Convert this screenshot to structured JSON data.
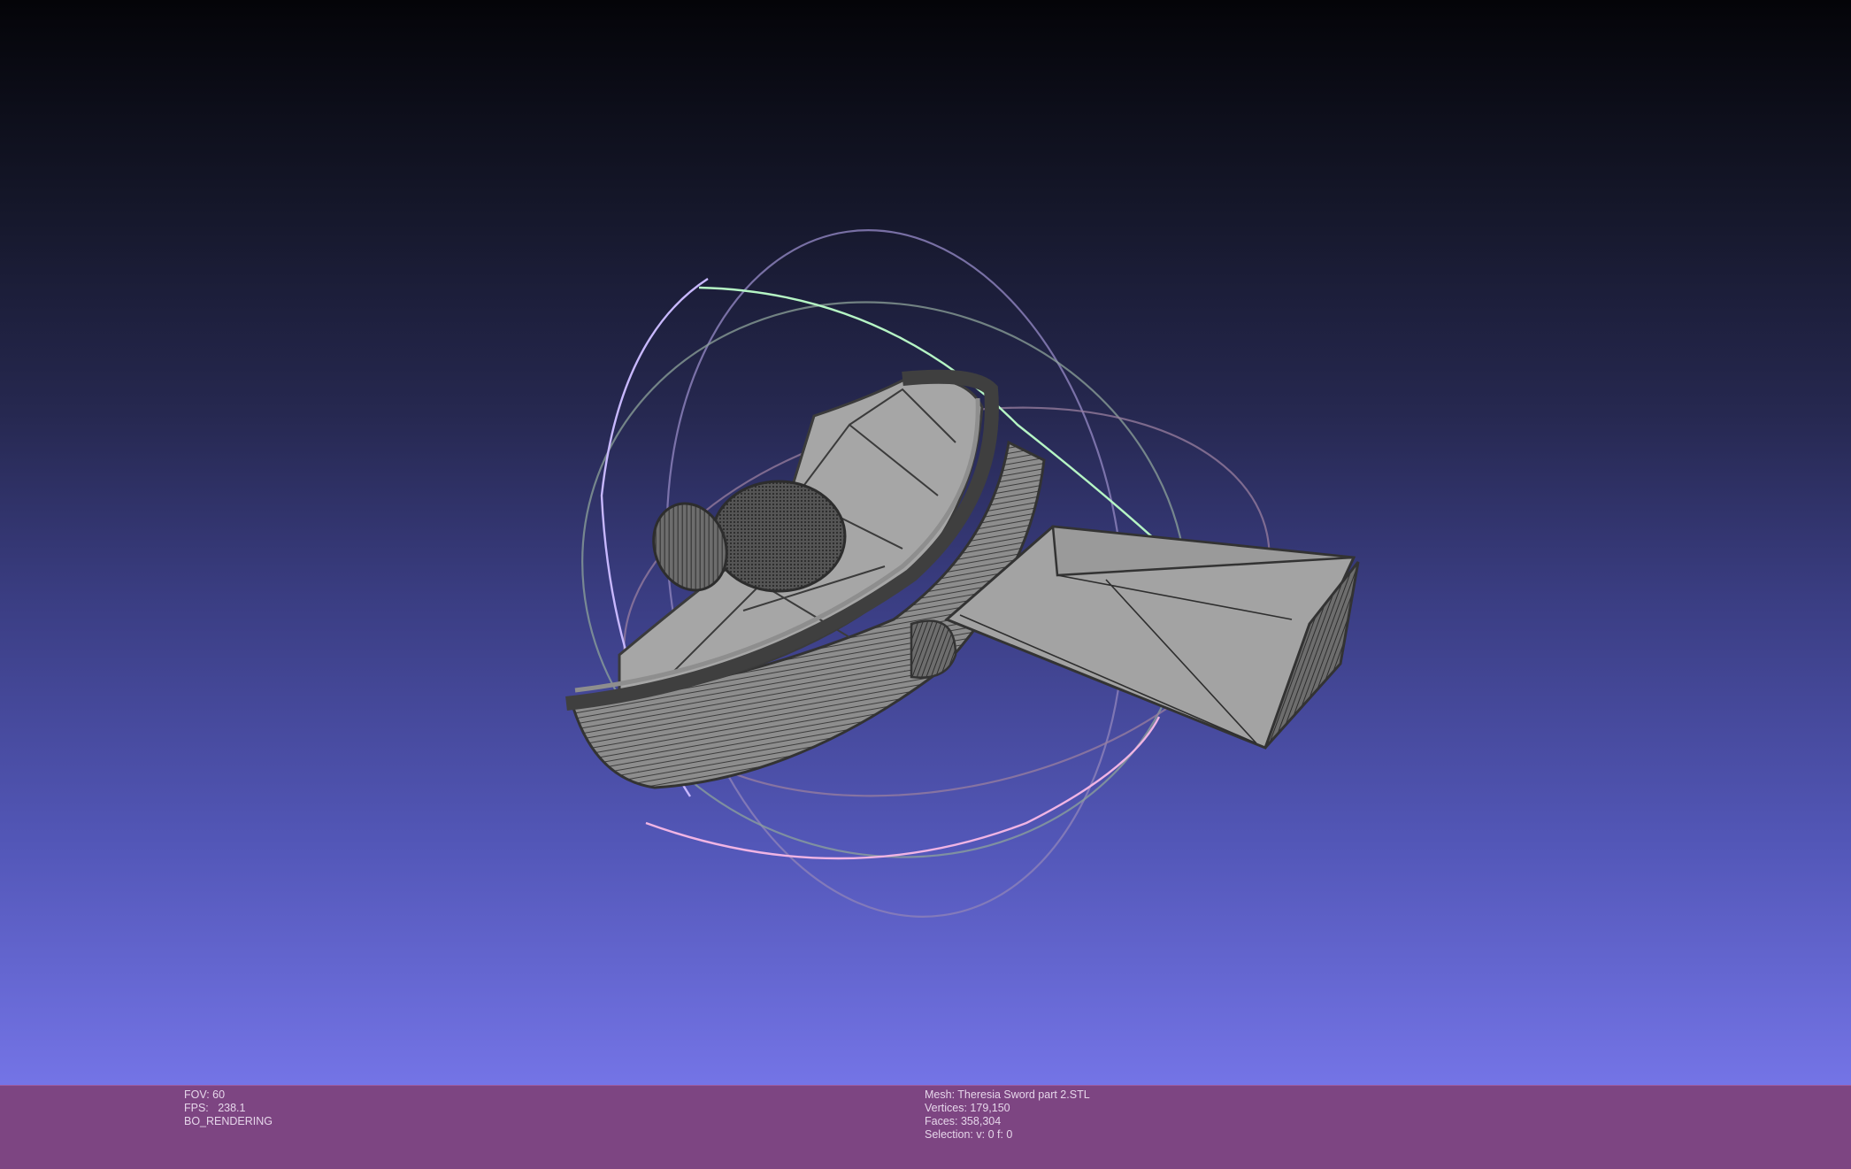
{
  "viewer": {
    "background_top": "#040408",
    "background_bottom": "#7474e6",
    "mesh_color": "#9c9c9c",
    "wire_color": "#3b3b3b",
    "trackball_colors": {
      "x_ring": "#b9aaf0",
      "y_ring": "#a8f0b8",
      "z_ring": "#f0b4e0"
    }
  },
  "info_left": {
    "fov": "FOV: 60",
    "fps": "FPS:   238.1",
    "mode": "BO_RENDERING"
  },
  "info_right": {
    "mesh": "Mesh: Theresia Sword part 2.STL",
    "vertices": "Vertices: 179,150",
    "faces": "Faces: 358,304",
    "selection": "Selection: v: 0 f: 0"
  },
  "info_bar_color": "#7d4582"
}
